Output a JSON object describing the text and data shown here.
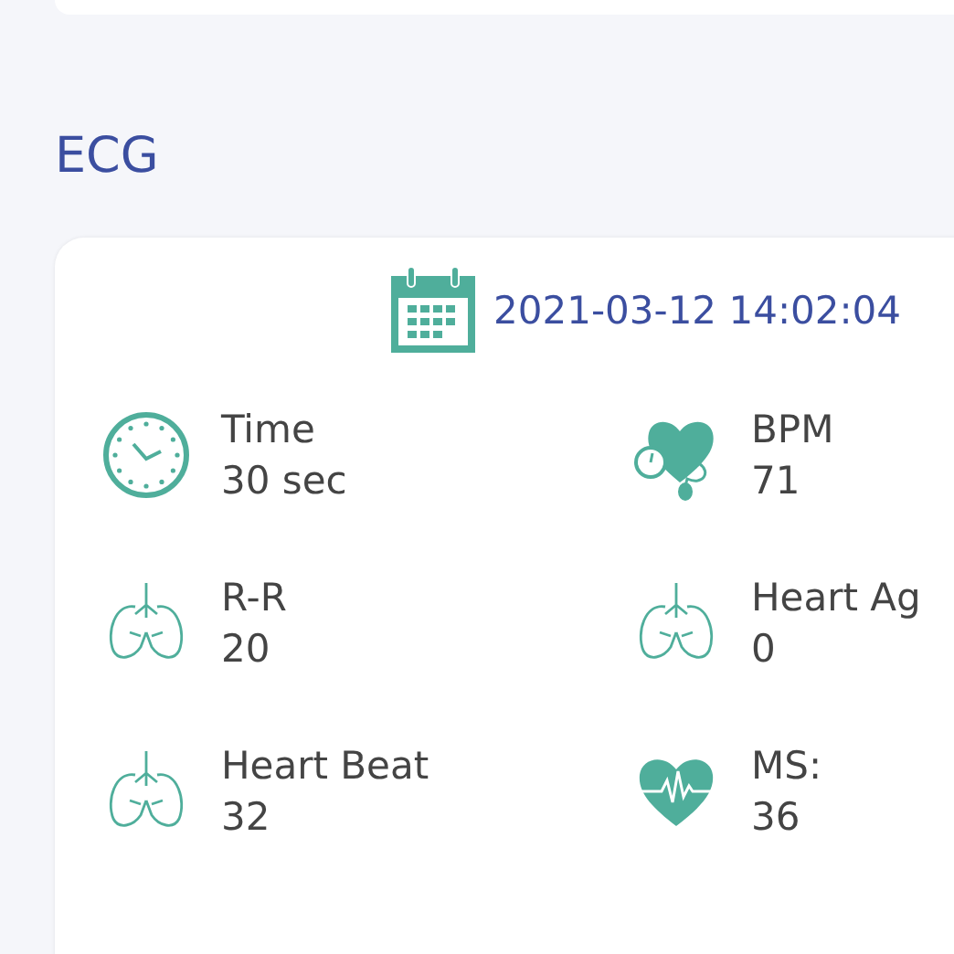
{
  "section_title": "ECG",
  "record": {
    "datetime": "2021-03-12 14:02:04"
  },
  "metrics": [
    {
      "kind": "clock",
      "label": "Time",
      "value": "30 sec"
    },
    {
      "kind": "bpm",
      "label": "BPM",
      "value": "71"
    },
    {
      "kind": "lungs",
      "label": "R-R",
      "value": "20"
    },
    {
      "kind": "lungs",
      "label": "Heart Ag",
      "value": "0"
    },
    {
      "kind": "lungs",
      "label": "Heart Beat",
      "value": "32"
    },
    {
      "kind": "pulse",
      "label": "MS:",
      "value": "36"
    }
  ]
}
